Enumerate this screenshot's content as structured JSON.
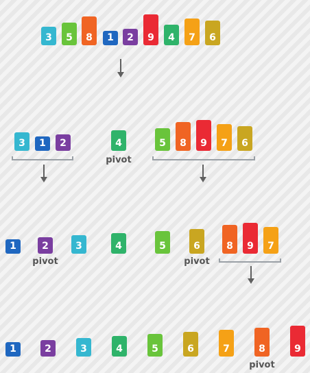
{
  "colors": {
    "1": "#1f67c0",
    "2": "#7a3ea0",
    "3": "#35b7d0",
    "4": "#2fb36a",
    "5": "#69c43b",
    "6": "#c9a621",
    "7": "#f5a116",
    "8": "#f06423",
    "9": "#ea2a34"
  },
  "pivot_label": "pivot",
  "rows": [
    {
      "groups": [
        {
          "values": [
            3,
            5,
            8,
            1,
            2,
            9,
            4,
            7,
            6
          ]
        }
      ]
    },
    {
      "groups": [
        {
          "values": [
            3,
            1,
            2
          ]
        },
        {
          "values": [
            4
          ],
          "pivot": true
        },
        {
          "values": [
            5,
            8,
            9,
            7,
            6
          ]
        }
      ]
    },
    {
      "groups": [
        {
          "values": [
            1
          ]
        },
        {
          "values": [
            2
          ],
          "pivot": true
        },
        {
          "values": [
            3
          ]
        },
        {
          "values": [
            4
          ]
        },
        {
          "values": [
            5
          ]
        },
        {
          "values": [
            6
          ],
          "pivot": true
        },
        {
          "values": [
            8,
            9,
            7
          ]
        }
      ]
    },
    {
      "groups": [
        {
          "values": [
            1
          ]
        },
        {
          "values": [
            2
          ]
        },
        {
          "values": [
            3
          ]
        },
        {
          "values": [
            4
          ]
        },
        {
          "values": [
            5
          ]
        },
        {
          "values": [
            6
          ]
        },
        {
          "values": [
            7
          ]
        },
        {
          "values": [
            8
          ],
          "pivot": true
        },
        {
          "values": [
            9
          ]
        }
      ]
    }
  ]
}
